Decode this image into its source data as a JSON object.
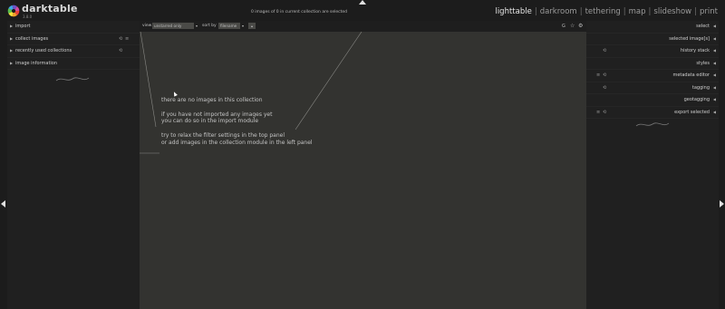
{
  "app": {
    "name": "darktable",
    "subtitle": "3.8.0"
  },
  "top": {
    "collection_status": "0 images of 0 in current collection are selected"
  },
  "views": [
    {
      "label": "lighttable",
      "active": true
    },
    {
      "label": "darkroom",
      "active": false
    },
    {
      "label": "tethering",
      "active": false
    },
    {
      "label": "map",
      "active": false
    },
    {
      "label": "slideshow",
      "active": false
    },
    {
      "label": "print",
      "active": false
    }
  ],
  "views_separator": "|",
  "left_panel": {
    "modules": [
      {
        "label": "import"
      },
      {
        "label": "collect images"
      },
      {
        "label": "recently used collections"
      },
      {
        "label": "image information"
      }
    ]
  },
  "right_panel": {
    "modules": [
      {
        "label": "select"
      },
      {
        "label": "selected image[s]"
      },
      {
        "label": "history stack"
      },
      {
        "label": "styles"
      },
      {
        "label": "metadata editor"
      },
      {
        "label": "tagging"
      },
      {
        "label": "geotagging"
      },
      {
        "label": "export selected"
      }
    ]
  },
  "filterbar": {
    "view_label": "view",
    "view_value": "unstarred only",
    "sort_label": "sort by",
    "sort_value": "filename"
  },
  "center": {
    "message_lines": [
      "there are no images in this collection",
      "",
      "if you have not imported any images yet",
      "you can do so in the import module",
      "",
      "try to relax the filter settings in the top panel",
      "or add images in the collection module in the left panel"
    ]
  },
  "colors": {
    "panel_bg": "#202020",
    "center_bg": "#333330",
    "text": "#c8c8c8",
    "logo": [
      "#e8413b",
      "#f2a02c",
      "#f5e33b",
      "#59c04f",
      "#3fa6e6",
      "#6a53c9",
      "#d24a9e"
    ]
  },
  "icons": {
    "left_arrow": "triangle-right-icon",
    "right_arrow": "triangle-left-icon",
    "preset": "preset-icon",
    "reset": "reset-icon",
    "star": "star-icon",
    "gear": "gear-icon"
  }
}
